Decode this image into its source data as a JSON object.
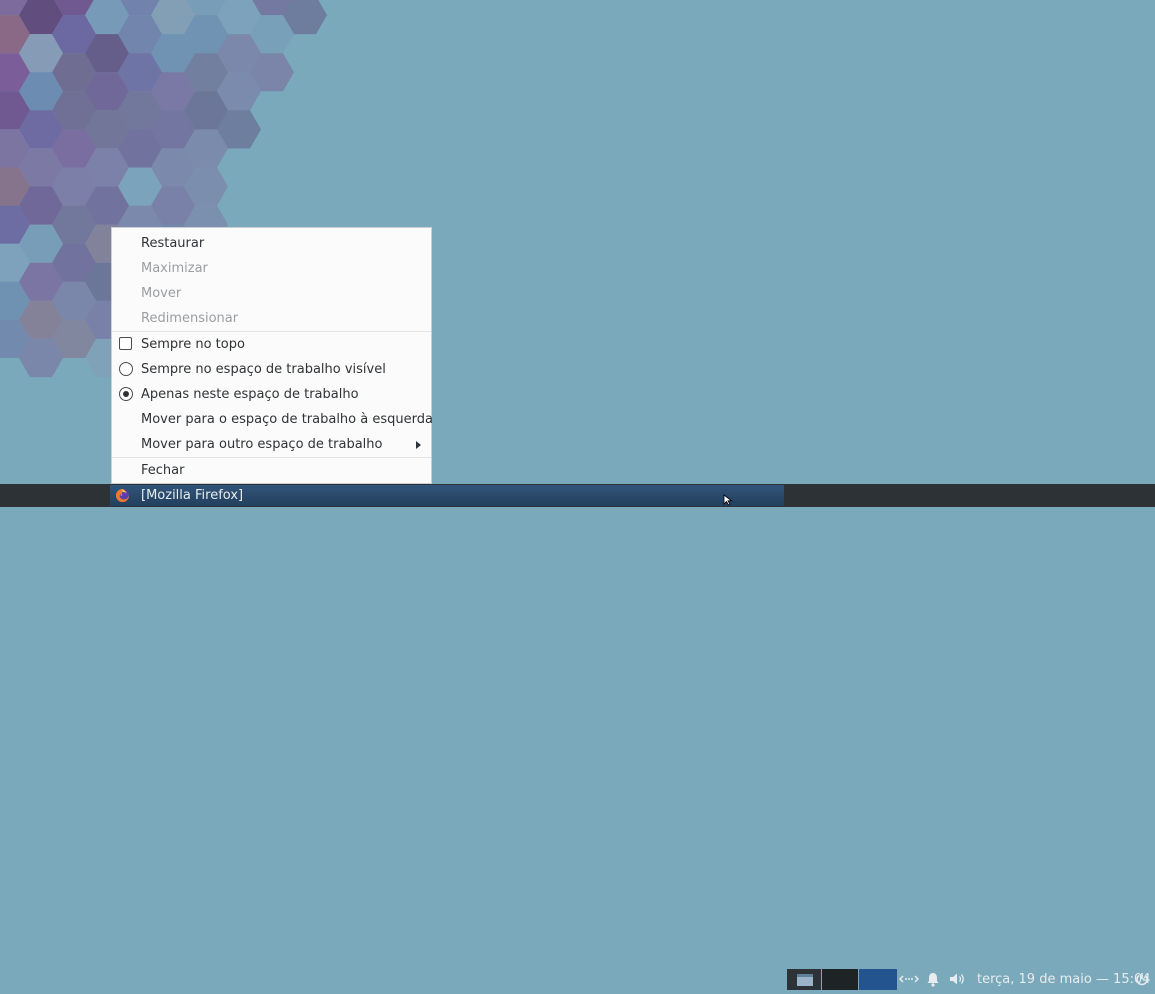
{
  "context_menu": {
    "items": [
      {
        "label": "Restaurar"
      },
      {
        "label": "Maximizar"
      },
      {
        "label": "Mover"
      },
      {
        "label": "Redimensionar"
      },
      {
        "label": "Sempre no topo"
      },
      {
        "label": "Sempre no espaço de trabalho visível"
      },
      {
        "label": "Apenas neste espaço de trabalho"
      },
      {
        "label": "Mover para o espaço de trabalho à esquerda"
      },
      {
        "label": "Mover para outro espaço de trabalho"
      },
      {
        "label": "Fechar"
      }
    ]
  },
  "taskbar": {
    "task_title": "[Mozilla Firefox]",
    "clock": "terça, 19 de maio — 15:04",
    "icons": [
      "firefox-icon",
      "window-icon",
      "network-icon",
      "bell-icon",
      "volume-icon",
      "power-icon"
    ]
  },
  "colors": {
    "desktop": "#79a9ba",
    "taskbar": "#2c3236",
    "active_task": "#31547a",
    "active_workspace": "#23548f"
  }
}
